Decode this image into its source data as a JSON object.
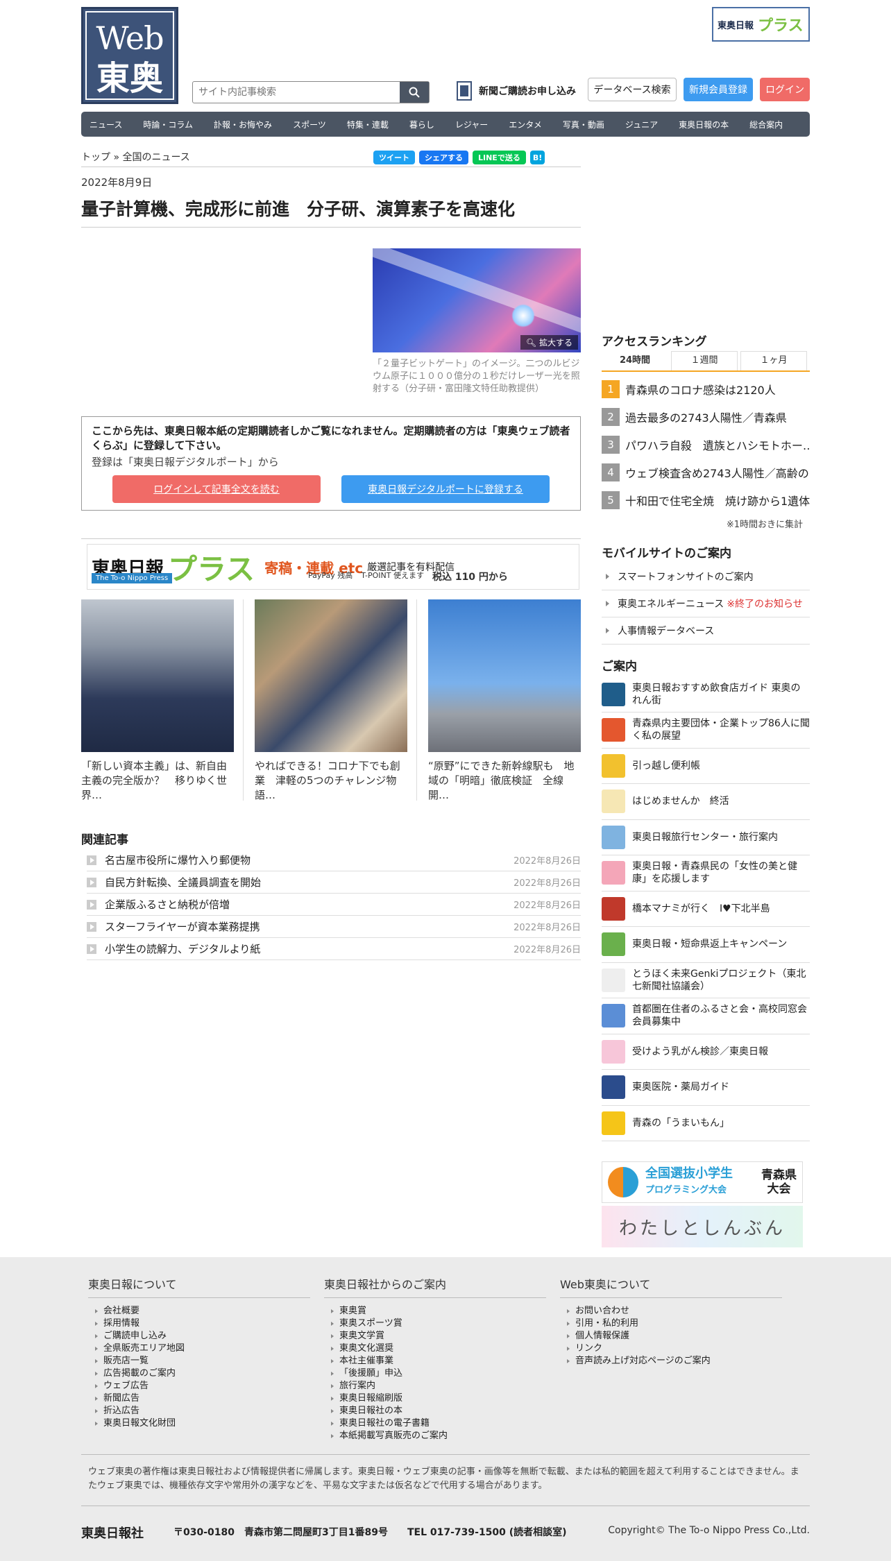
{
  "header": {
    "logo_line1": "Web",
    "logo_line2": "東奥",
    "plus_logo_a": "東奥日報",
    "plus_logo_b": "プラス",
    "search_placeholder": "サイト内記事検索",
    "subscribe": "新聞ご購読お申し込み",
    "db_search": "データベース検索",
    "register": "新規会員登録",
    "login": "ログイン"
  },
  "nav": [
    "ニュース",
    "時論・コラム",
    "訃報・お悔やみ",
    "スポーツ",
    "特集・連載",
    "暮らし",
    "レジャー",
    "エンタメ",
    "写真・動画",
    "ジュニア",
    "東奥日報の本",
    "総合案内"
  ],
  "breadcrumb": {
    "top": "トップ",
    "sep": "»",
    "current": "全国のニュース"
  },
  "share": {
    "tweet": "ツイート",
    "facebook": "シェアする",
    "line": "LINEで送る",
    "hatena": "B!"
  },
  "article": {
    "date": "2022年8月9日",
    "title": "量子計算機、完成形に前進　分子研、演算素子を高速化",
    "zoom": "拡大する",
    "caption": "「２量子ビットゲート」のイメージ。二つのルビジウム原子に１０００億分の１秒だけレーザー光を照射する（分子研・富田隆文特任助教提供）"
  },
  "paywall": {
    "line1": "ここから先は、東奥日報本紙の定期購読者しかご覧になれません。定期購読者の方は「東奥ウェブ読者くらぶ」に登録して下さい。",
    "line2": "登録は「東奥日報デジタルポート」から",
    "btn_login": "ログインして記事全文を読む",
    "btn_register": "東奥日報デジタルポートに登録する"
  },
  "banner": {
    "logo": "東奥日報",
    "plus": "プラス",
    "headline": "寄稿・連載 etc",
    "headline2": "厳選記事を有料配信",
    "english": "The To-o Nippo Press",
    "paypay": "PayPay 残高",
    "tpoint": "T-POINT 使えます",
    "price": "税込 110 円から"
  },
  "cards": [
    {
      "text": "「新しい資本主義」は、新自由主義の完全版か？　移りゆく世界…"
    },
    {
      "text": "やればできる！コロナ下でも創業　津軽の5つのチャレンジ物語…"
    },
    {
      "text": "“原野”にできた新幹線駅も　地域の「明暗」徹底検証　全線開…"
    }
  ],
  "related": {
    "heading": "関連記事",
    "items": [
      {
        "title": "名古屋市役所に爆竹入り郵便物",
        "date": "2022年8月26日"
      },
      {
        "title": "自民方針転換、全議員調査を開始",
        "date": "2022年8月26日"
      },
      {
        "title": "企業版ふるさと納税が倍増",
        "date": "2022年8月26日"
      },
      {
        "title": "スターフライヤーが資本業務提携",
        "date": "2022年8月26日"
      },
      {
        "title": "小学生の読解力、デジタルより紙",
        "date": "2022年8月26日"
      }
    ]
  },
  "ranking": {
    "heading": "アクセスランキング",
    "tabs": [
      "24時間",
      "１週間",
      "１ヶ月"
    ],
    "items": [
      {
        "n": "1",
        "title": "青森県のコロナ感染は2120人"
      },
      {
        "n": "2",
        "title": "過去最多の2743人陽性／青森県"
      },
      {
        "n": "3",
        "title": "パワハラ自殺　遺族とハシモトホー…"
      },
      {
        "n": "4",
        "title": "ウェブ検査含め2743人陽性／高齢の…"
      },
      {
        "n": "5",
        "title": "十和田で住宅全焼　焼け跡から1遺体"
      }
    ],
    "note": "※1時間おきに集計"
  },
  "mobile": {
    "heading": "モバイルサイトのご案内",
    "items": [
      {
        "label": "スマートフォンサイトのご案内",
        "extra": ""
      },
      {
        "label": "東奥エネルギーニュース",
        "extra": "※終了のお知らせ"
      },
      {
        "label": "人事情報データベース",
        "extra": ""
      }
    ]
  },
  "guide": {
    "heading": "ご案内",
    "items": [
      {
        "label": "東奥日報おすすめ飲食店ガイド 東奥のれん街",
        "color": "#1f5d8a"
      },
      {
        "label": "青森県内主要団体・企業トップ86人に聞く私の展望",
        "color": "#e4572e"
      },
      {
        "label": "引っ越し便利帳",
        "color": "#f2c12e"
      },
      {
        "label": "はじめませんか　終活",
        "color": "#f6e7b4"
      },
      {
        "label": "東奥日報旅行センター・旅行案内",
        "color": "#7fb3e0"
      },
      {
        "label": "東奥日報・青森県民の「女性の美と健康」を応援します",
        "color": "#f4a6b8"
      },
      {
        "label": "橋本マナミが行く　I♥下北半島",
        "color": "#c0392b"
      },
      {
        "label": "東奥日報・短命県返上キャンペーン",
        "color": "#6ab04c"
      },
      {
        "label": "とうほく未来Genkiプロジェクト（東北七新聞社協議会）",
        "color": "#eeeeee"
      },
      {
        "label": "首都圏在住者のふるさと会・高校同窓会　会員募集中",
        "color": "#5b8ed6"
      },
      {
        "label": "受けよう乳がん検診／東奥日報",
        "color": "#f7c6d9"
      },
      {
        "label": "東奥医院・薬局ガイド",
        "color": "#2b4c8c"
      },
      {
        "label": "青森の「うまいもん」",
        "color": "#f5c518"
      }
    ]
  },
  "side_banners": {
    "b1_title": "全国選抜小学生",
    "b1_sub": "プログラミング大会",
    "b1_right1": "青森県",
    "b1_right2": "大会",
    "b2": "わたしとしんぶん"
  },
  "footer": {
    "col1": {
      "heading": "東奥日報について",
      "items": [
        "会社概要",
        "採用情報",
        "ご購読申し込み",
        "全県販売エリア地図",
        "販売店一覧",
        "広告掲載のご案内",
        "ウェブ広告",
        "新聞広告",
        "折込広告",
        "東奥日報文化財団"
      ]
    },
    "col2": {
      "heading": "東奥日報社からのご案内",
      "items": [
        "東奥賞",
        "東奥スポーツ賞",
        "東奥文学賞",
        "東奥文化選奨",
        "本社主催事業",
        "「後援願」申込",
        "旅行案内",
        "東奥日報縮刷版",
        "東奥日報社の本",
        "東奥日報社の電子書籍",
        "本紙掲載写真販売のご案内"
      ]
    },
    "col3": {
      "heading": "Web東奥について",
      "items": [
        "お問い合わせ",
        "引用・私的利用",
        "個人情報保護",
        "リンク",
        "音声読み上げ対応ページのご案内"
      ]
    },
    "copyright_text": "ウェブ東奥の著作権は東奥日報社および情報提供者に帰属します。東奥日報・ウェブ東奥の記事・画像等を無断で転載、または私的範囲を超えて利用することはできません。またウェブ東奥では、機種依存文字や常用外の漢字などを、平易な文字または仮名などで代用する場合があります。",
    "company": "東奥日報社",
    "address": "〒030-0180　青森市第二問屋町3丁目1番89号　　TEL 017-739-1500 (読者相談室)",
    "copyright": "Copyright© The To-o Nippo Press Co.,Ltd."
  },
  "colors": {
    "nav_bg": "#4b5563",
    "accent_orange": "#f5a623",
    "login_red": "#f06b67",
    "register_blue": "#3d9bf0"
  }
}
